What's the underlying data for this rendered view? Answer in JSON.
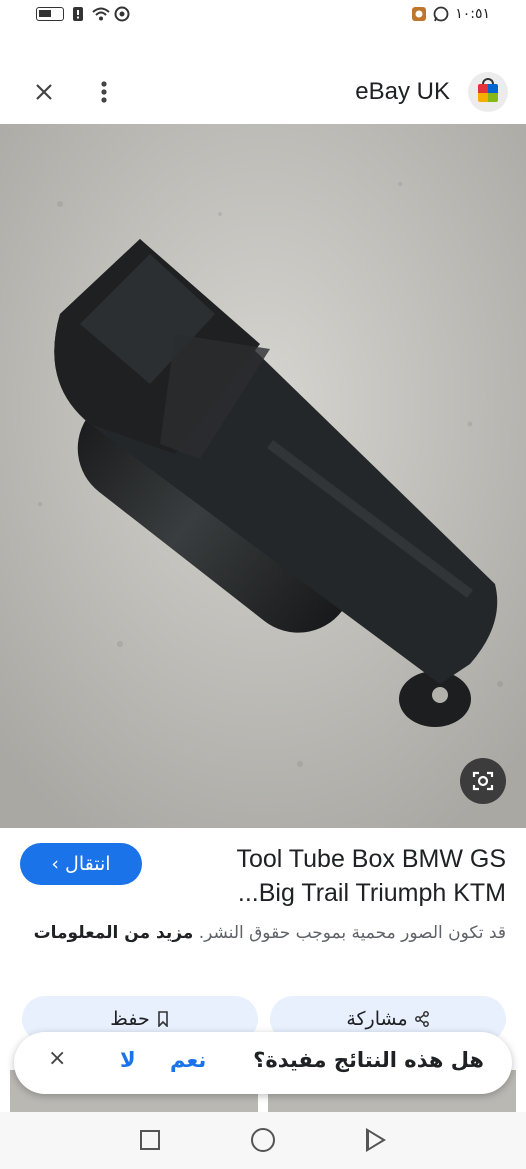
{
  "status": {
    "time": "١٠:٥١"
  },
  "topbar": {
    "site_title": "eBay UK",
    "close_icon": "close-icon",
    "menu_icon": "more-vert-icon"
  },
  "result": {
    "title_line1": "Tool Tube Box BMW GS",
    "title_line2": "Big Trail Triumph KTM...",
    "visit_label": "انتقال ›",
    "copyright_text": "قد تكون الصور محمية بموجب حقوق النشر.",
    "learn_more": "مزيد من المعلومات",
    "share_label": "مشاركة",
    "save_label": "حفظ"
  },
  "feedback": {
    "question": "هل هذه النتائج مفيدة؟",
    "yes_label": "نعم",
    "no_label": "لا",
    "close_label": "×"
  },
  "colors": {
    "accent": "#1a73e8",
    "chip_bg": "#e8f0fe"
  }
}
